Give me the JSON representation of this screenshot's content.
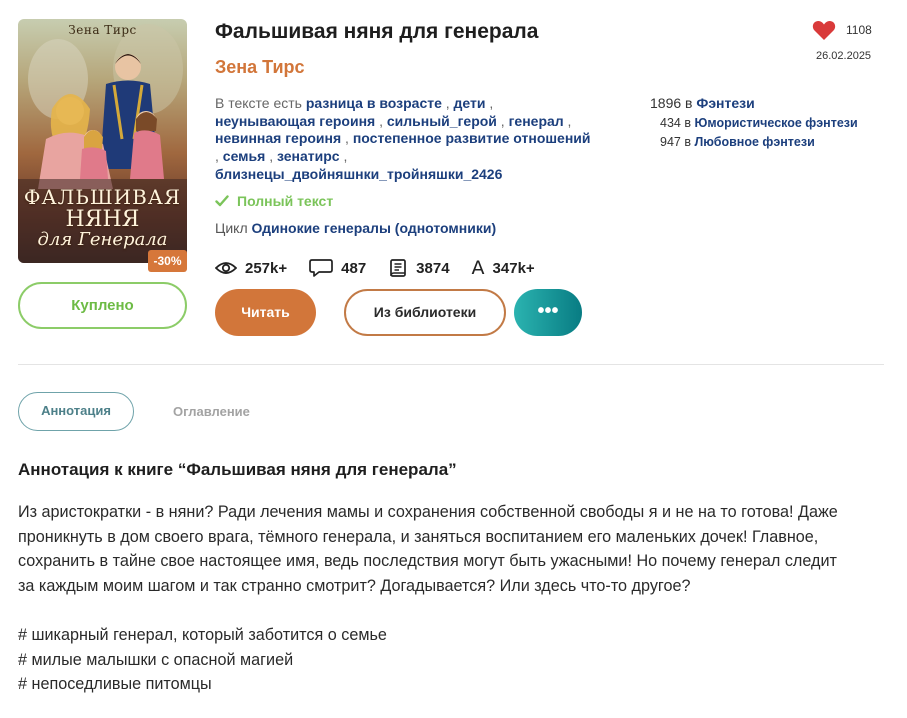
{
  "book": {
    "title": "Фальшивая няня для генерала",
    "author": "Зена Тирс",
    "cover": {
      "author": "Зена Тирс",
      "title_line1": "ФАЛЬШИВАЯ",
      "title_line2": "НЯНЯ",
      "title_line3": "для Генерала"
    },
    "discount": "-30%",
    "likes": "1108",
    "date": "26.02.2025",
    "tags_label": "В тексте есть",
    "tags": [
      "разница в возрасте",
      "дети",
      "неунывающая героиня",
      "сильный_герой",
      "генерал",
      "невинная героиня",
      "постепенное развитие отношений",
      "семья",
      "зенатирс",
      "близнецы_двойняшнки_тройняшки_2426"
    ],
    "ranks": {
      "main": {
        "pos": "1896",
        "in": "в",
        "genre": "Фэнтези"
      },
      "sub": [
        {
          "pos": "434",
          "in": "в",
          "genre": "Юмористическое фэнтези"
        },
        {
          "pos": "947",
          "in": "в",
          "genre": "Любовное фэнтези"
        }
      ]
    },
    "full_text": "Полный текст",
    "cycle_label": "Цикл",
    "cycle_name": "Одинокие генералы (однотомники)",
    "stats": {
      "views": "257k+",
      "comments": "487",
      "pages": "3874",
      "chars": "347k+",
      "chars_icon": "A"
    }
  },
  "buttons": {
    "bought": "Куплено",
    "read": "Читать",
    "library": "Из библиотеки",
    "more": "•••"
  },
  "tabs": {
    "annotation": "Аннотация",
    "contents": "Оглавление"
  },
  "annotation": {
    "heading": "Аннотация к книге “Фальшивая няня для генерала”",
    "lines": [
      "Из аристократки - в няни? Ради лечения мамы и сохранения собственной свободы я и не на то готова! Даже",
      "проникнуть в дом своего врага, тёмного генерала, и заняться воспитанием его маленьких дочек! Главное,",
      "сохранить в тайне свое настоящее имя, ведь последствия могут быть ужасными! Но почему генерал следит",
      "за каждым моим шагом и так странно смотрит? Догадывается? Или здесь что-то другое?"
    ],
    "hashtags": [
      "# шикарный генерал, который заботится о семье",
      "# милые малышки с опасной магией",
      "# непоседливые питомцы"
    ]
  },
  "colors": {
    "accent_orange": "#d2763a",
    "link_blue": "#1c3f7d",
    "green": "#7bc45a",
    "teal": "#2bb3b0",
    "heart": "#d93a3a"
  },
  "icons": {
    "heart": "heart-icon",
    "check": "check-icon",
    "views": "eye-icon",
    "comments": "comment-icon",
    "pages": "book-icon",
    "chars": "letter-a-icon"
  }
}
